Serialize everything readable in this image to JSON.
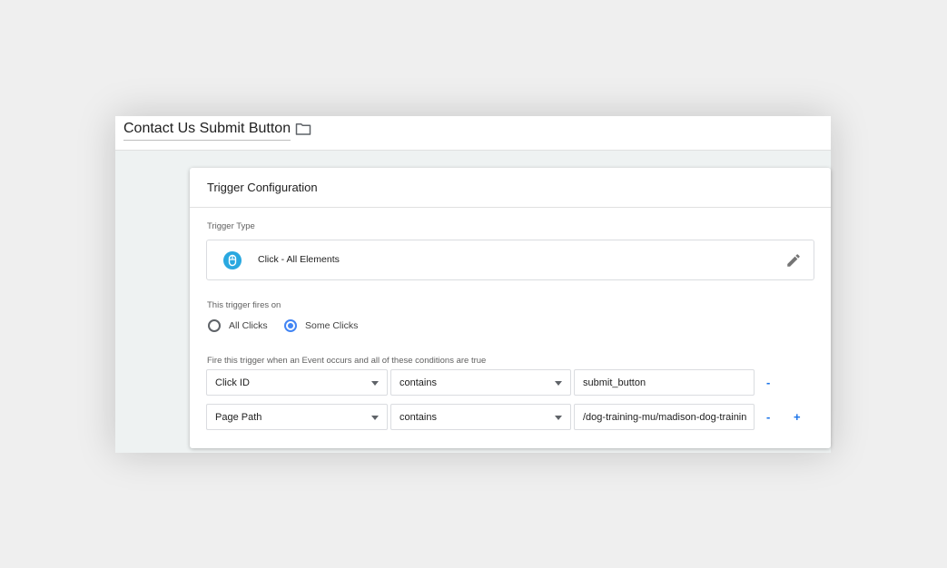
{
  "header": {
    "title": "Contact Us Submit Button",
    "folder_icon": "folder-icon"
  },
  "card": {
    "title": "Trigger Configuration",
    "trigger_type_label": "Trigger Type",
    "trigger_type": {
      "name": "Click - All Elements",
      "icon": "click-cursor-icon",
      "edit_icon": "pencil-icon"
    },
    "fires_on_label": "This trigger fires on",
    "fires_on_options": [
      {
        "label": "All Clicks",
        "selected": false
      },
      {
        "label": "Some Clicks",
        "selected": true
      }
    ],
    "conditions_label": "Fire this trigger when an Event occurs and all of these conditions are true",
    "conditions": [
      {
        "variable": "Click ID",
        "operator": "contains",
        "value": "submit_button",
        "remove_label": "-"
      },
      {
        "variable": "Page Path",
        "operator": "contains",
        "value": "/dog-training-mu/madison-dog-training",
        "remove_label": "-",
        "add_label": "+"
      }
    ]
  },
  "colors": {
    "accent": "#1a73e8",
    "radio_selected": "#4285f4",
    "trigger_icon": "#29a8e0"
  }
}
